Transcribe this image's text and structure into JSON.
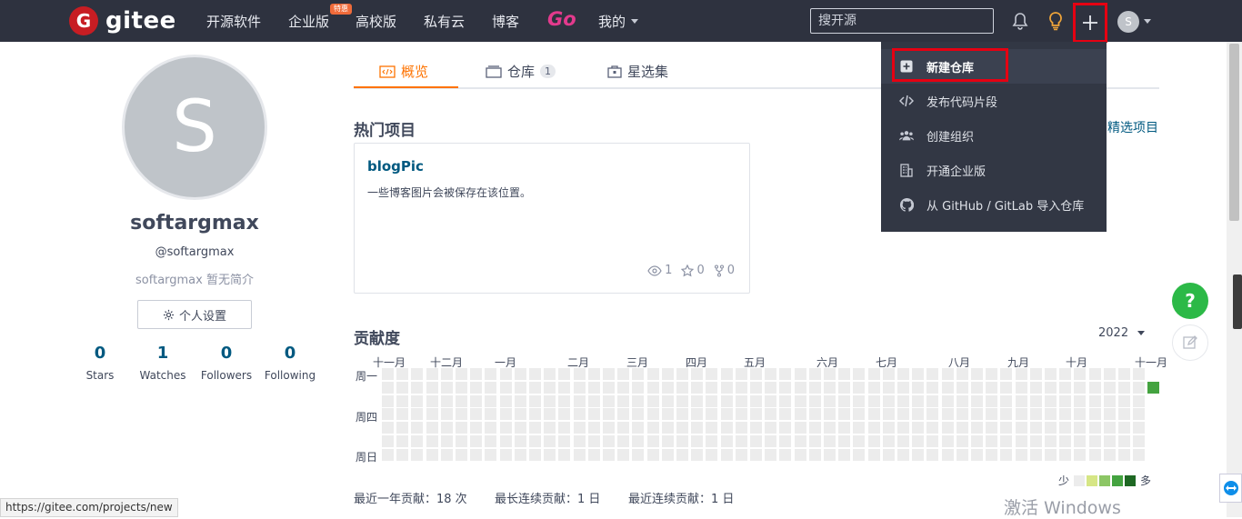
{
  "header": {
    "logo_mark": "G",
    "logo_text": "gitee",
    "nav": [
      "开源软件",
      "企业版",
      "高校版",
      "私有云",
      "博客"
    ],
    "enterprise_badge": "特惠",
    "go_label": "Go",
    "mine_label": "我的",
    "search_placeholder": "搜开源",
    "avatar_letter": "S",
    "colors": {
      "bar": "#2e323f",
      "logo_red": "#c71d23",
      "highlight_red": "#e60012"
    }
  },
  "profile": {
    "avatar_letter": "S",
    "username": "softargmax",
    "handle": "@softargmax",
    "bio": "softargmax 暂无简介",
    "settings_label": "个人设置",
    "stats": [
      {
        "num": "0",
        "label": "Stars"
      },
      {
        "num": "1",
        "label": "Watches"
      },
      {
        "num": "0",
        "label": "Followers"
      },
      {
        "num": "0",
        "label": "Following"
      }
    ]
  },
  "tabs": {
    "overview": "概览",
    "repos": "仓库",
    "repos_count": "1",
    "starred": "星选集"
  },
  "popular": {
    "title": "热门项目",
    "featured_link": "精选项目",
    "project": {
      "name": "blogPic",
      "desc": "一些博客图片会被保存在该位置。",
      "watch": "1",
      "star": "0",
      "fork": "0"
    }
  },
  "contrib": {
    "title": "贡献度",
    "year": "2022",
    "months": [
      "十一月",
      "十二月",
      "一月",
      "二月",
      "三月",
      "四月",
      "五月",
      "六月",
      "七月",
      "八月",
      "九月",
      "十月",
      "十一月"
    ],
    "days": [
      "周一",
      "周四",
      "周日"
    ],
    "legend_low": "少",
    "legend_high": "多",
    "legend_colors": [
      "#ececec",
      "#d6e685",
      "#8cc665",
      "#44a340",
      "#1e6823"
    ],
    "active_color": "#44a340",
    "summary": [
      "最近一年贡献：18 次",
      "最长连续贡献：1 日",
      "最近连续贡献：1 日"
    ]
  },
  "dropdown": {
    "items": [
      {
        "icon": "plus-square-icon",
        "label": "新建仓库"
      },
      {
        "icon": "code-icon",
        "label": "发布代码片段"
      },
      {
        "icon": "team-icon",
        "label": "创建组织"
      },
      {
        "icon": "building-icon",
        "label": "开通企业版"
      },
      {
        "icon": "github-icon",
        "label": "从 GitHub / GitLab 导入仓库"
      }
    ]
  },
  "status_url": "https://gitee.com/projects/new",
  "help_label": "?",
  "watermark": "激活 Windows"
}
